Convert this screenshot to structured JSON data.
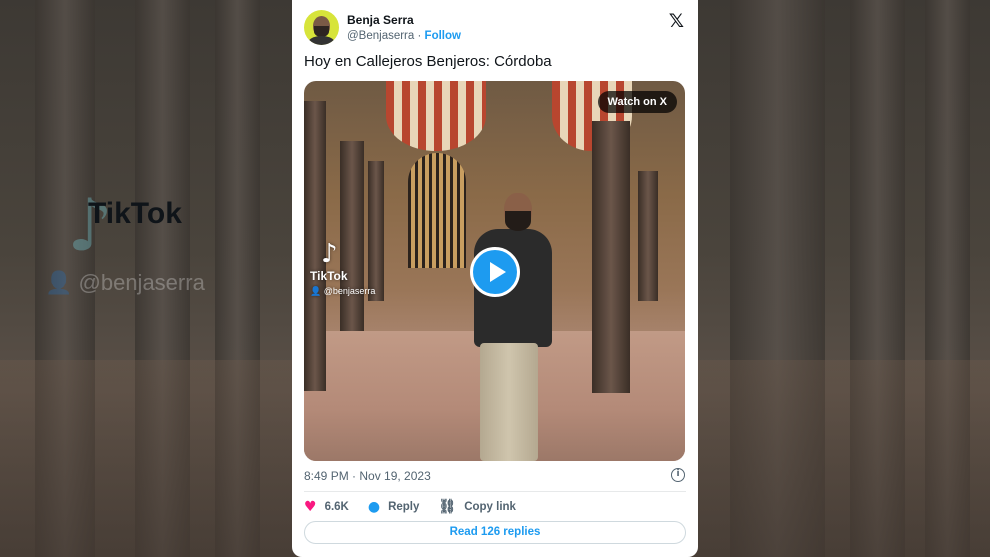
{
  "author": {
    "name": "Benja Serra",
    "handle": "@Benjaserra",
    "separator": "·",
    "follow_label": "Follow"
  },
  "close_icon": "x-logo-icon",
  "tweet": {
    "text": "Hoy en Callejeros Benjeros: Córdoba",
    "timestamp": "8:49 PM · Nov 19, 2023"
  },
  "video": {
    "watch_label": "Watch on X",
    "tiktok_name": "TikTok",
    "tiktok_handle": "@benjaserra",
    "play_icon": "play-icon"
  },
  "background_overlay": {
    "tiktok_name": "TikTok",
    "tiktok_handle": "@benjaserra"
  },
  "actions": {
    "likes": "6.6K",
    "reply_label": "Reply",
    "copy_label": "Copy link"
  },
  "read_replies_label": "Read 126 replies",
  "colors": {
    "accent": "#1d9bf0",
    "like": "#f91880",
    "avatar_bg": "#d7e43a"
  }
}
